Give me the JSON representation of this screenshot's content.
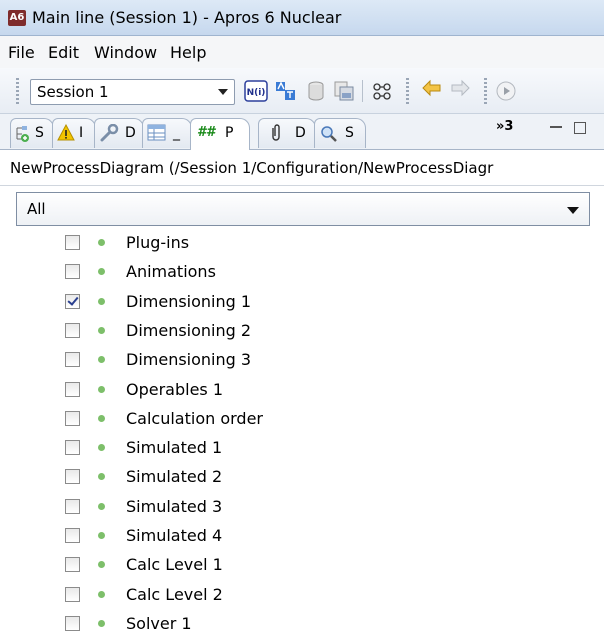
{
  "window": {
    "app_badge": "A6",
    "title": "Main line (Session 1) - Apros 6 Nuclear"
  },
  "menu": [
    "File",
    "Edit",
    "Window",
    "Help"
  ],
  "toolbar": {
    "session_value": "Session 1",
    "icons": [
      "nl-toggle-icon",
      "translate-icon",
      "database-icon",
      "copy-database-icon",
      "network-icon",
      "undo-icon",
      "redo-icon",
      "play-icon"
    ]
  },
  "tabs": [
    {
      "label": "S",
      "icon": "tree-icon"
    },
    {
      "label": "I",
      "icon": "warning-icon"
    },
    {
      "label": "D",
      "icon": "wrench-icon"
    },
    {
      "label": "_",
      "icon": "table-icon"
    },
    {
      "label": "P",
      "icon": "hash-icon",
      "active": true
    },
    {
      "label": "D",
      "icon": "clip-icon"
    },
    {
      "label": "S",
      "icon": "search-icon"
    }
  ],
  "tab_overflow": "»3",
  "path": "NewProcessDiagram (/Session 1/Configuration/NewProcessDiagr",
  "filter": {
    "value": "All"
  },
  "layers": [
    {
      "label": "Plug-ins",
      "checked": false
    },
    {
      "label": "Animations",
      "checked": false
    },
    {
      "label": "Dimensioning 1",
      "checked": true
    },
    {
      "label": "Dimensioning 2",
      "checked": false
    },
    {
      "label": "Dimensioning 3",
      "checked": false
    },
    {
      "label": "Operables 1",
      "checked": false
    },
    {
      "label": "Calculation order",
      "checked": false
    },
    {
      "label": "Simulated 1",
      "checked": false
    },
    {
      "label": "Simulated 2",
      "checked": false
    },
    {
      "label": "Simulated 3",
      "checked": false
    },
    {
      "label": "Simulated 4",
      "checked": false
    },
    {
      "label": "Calc Level 1",
      "checked": false
    },
    {
      "label": "Calc Level 2",
      "checked": false
    },
    {
      "label": "Solver 1",
      "checked": false
    }
  ],
  "colors": {
    "dot_green": "#7dbf6a",
    "warning_yellow": "#f2c400",
    "active_tab_text": "#1a8a1a"
  }
}
